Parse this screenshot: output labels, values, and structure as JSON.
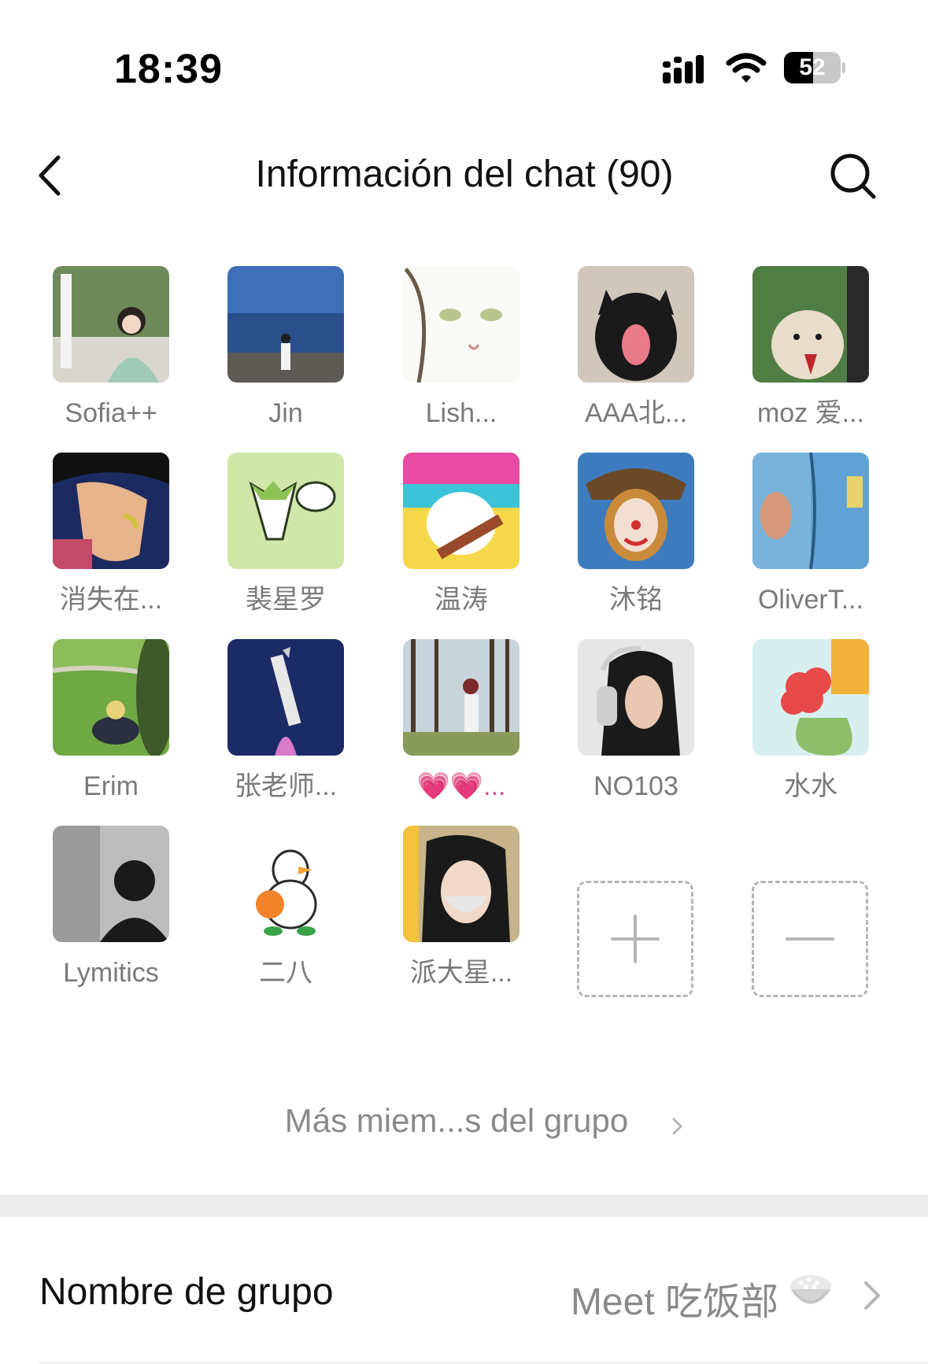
{
  "status_bar": {
    "time": "18:39",
    "battery_level": "52",
    "battery_percent": 52
  },
  "nav": {
    "title": "Información del chat (90)"
  },
  "members": [
    {
      "name": "Sofia++",
      "avatar": "photo-woman-green-dress"
    },
    {
      "name": "Jin",
      "avatar": "photo-person-by-sea"
    },
    {
      "name": "Lish...",
      "avatar": "drawing-anime-girl"
    },
    {
      "name": "AAA北...",
      "avatar": "photo-black-dog"
    },
    {
      "name": "moz 爱...",
      "avatar": "photo-hamster"
    },
    {
      "name": "消失在...",
      "avatar": "drawing-manga-man"
    },
    {
      "name": "裴星罗",
      "avatar": "drawing-green-onion"
    },
    {
      "name": "温涛",
      "avatar": "drawing-cat-guitar"
    },
    {
      "name": "沐铭",
      "avatar": "painting-clown"
    },
    {
      "name": "OliverT...",
      "avatar": "photo-blue-reflection"
    },
    {
      "name": "Erim",
      "avatar": "photo-grass-field"
    },
    {
      "name": "张老师...",
      "avatar": "photo-rocket"
    },
    {
      "name": "💗💗...",
      "avatar": "photo-woman-forest"
    },
    {
      "name": "NO103",
      "avatar": "photo-girl-headphones"
    },
    {
      "name": "水水",
      "avatar": "drawing-red-flower"
    },
    {
      "name": "Lymitics",
      "avatar": "photo-dark-silhouette"
    },
    {
      "name": "二八",
      "avatar": "drawing-duck-orange"
    },
    {
      "name": "派大星...",
      "avatar": "photo-girl-mask"
    }
  ],
  "actions": {
    "add_label": "add-member",
    "remove_label": "remove-member"
  },
  "more_members": {
    "label": "Más miem...s del grupo"
  },
  "group_name_row": {
    "label": "Nombre de grupo",
    "value": "Meet 吃饭部"
  },
  "colors": {
    "divider": "#ededed",
    "secondary_text": "#8a8a8a",
    "accent_pink": "#e8459a"
  }
}
